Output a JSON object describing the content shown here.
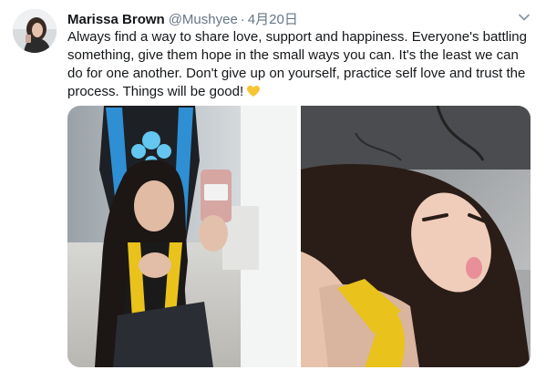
{
  "tweet": {
    "author_name": "Marissa Brown",
    "handle": "@Mushyee",
    "separator": "·",
    "date": "4月20日",
    "text": "Always find a way to share love, support and happiness. Everyone's battling something, give them hope in the small ways you can. It's the least we can do for one another. Don't give up on yourself, practice self love and trust the process. Things will be good!",
    "emoji": "yellow-heart-icon"
  },
  "colors": {
    "name": "#14171a",
    "meta": "#657786",
    "heart": "#f7c534",
    "chair_blue": "#2f8fd4",
    "top_yellow": "#e9c21c"
  }
}
